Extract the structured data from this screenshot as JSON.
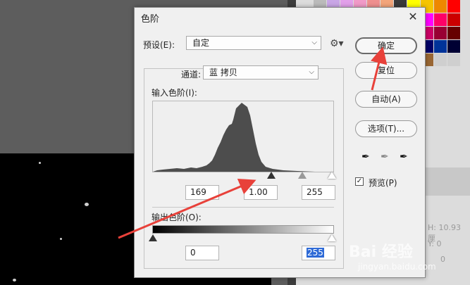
{
  "background": {
    "panel_text_1": "H: 10.93 厘",
    "panel_text_2": "Y: 0",
    "panel_text_3": "0"
  },
  "dialog": {
    "title": "色阶",
    "close_glyph": "✕",
    "preset_label": "预设(E):",
    "preset_value": "自定",
    "channel_label": "通道:",
    "channel_value": "蓝 拷贝",
    "input_levels_label": "输入色阶(I):",
    "input_black": "169",
    "input_mid": "1.00",
    "input_white": "255",
    "output_levels_label": "输出色阶(O):",
    "output_black": "0",
    "output_white": "255",
    "buttons": {
      "ok": "确定",
      "cancel": "复位",
      "auto": "自动(A)",
      "options": "选项(T)..."
    },
    "preview_label": "预览(P)",
    "preview_checked": true
  },
  "watermark": {
    "brand": "Bai 经验",
    "url": "jingyan.baidu.com"
  },
  "colors": {
    "histogram": "#4d4d4d",
    "annotation_arrow": "#e8413a",
    "selection": "#2e6ad6"
  }
}
